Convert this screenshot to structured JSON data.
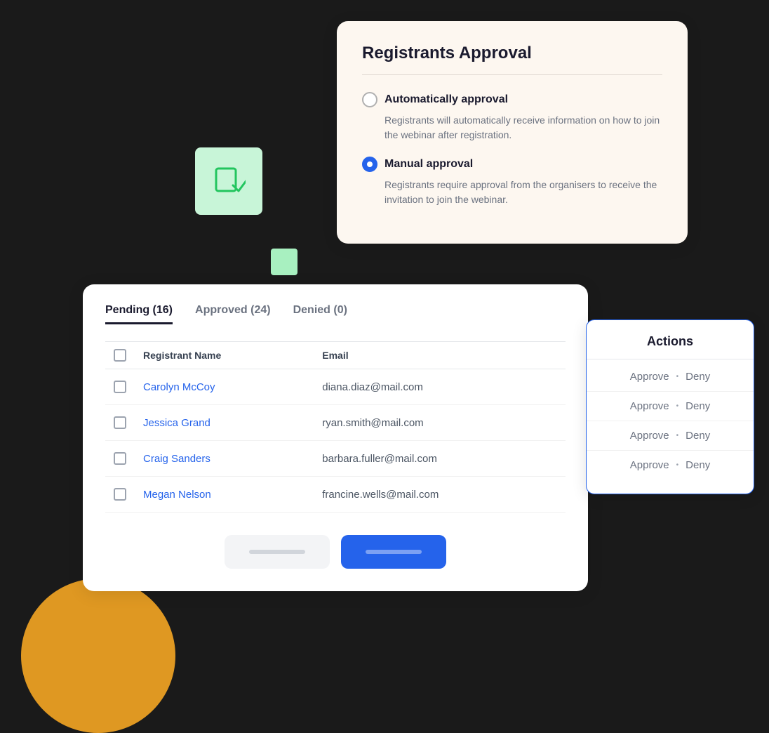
{
  "approval_card": {
    "title": "Registrants Approval",
    "options": [
      {
        "id": "auto",
        "label": "Automatically approval",
        "description": "Registrants will automatically receive information on how to join the webinar after registration.",
        "active": false
      },
      {
        "id": "manual",
        "label": "Manual approval",
        "description": "Registrants require approval from the organisers to receive the invitation to join the webinar.",
        "active": true
      }
    ]
  },
  "table": {
    "tabs": [
      {
        "label": "Pending (16)",
        "active": true
      },
      {
        "label": "Approved (24)",
        "active": false
      },
      {
        "label": "Denied (0)",
        "active": false
      }
    ],
    "columns": [
      "Registrant Name",
      "Email"
    ],
    "rows": [
      {
        "name": "Carolyn McCoy",
        "email": "diana.diaz@mail.com"
      },
      {
        "name": "Jessica Grand",
        "email": "ryan.smith@mail.com"
      },
      {
        "name": "Craig Sanders",
        "email": "barbara.fuller@mail.com"
      },
      {
        "name": "Megan Nelson",
        "email": "francine.wells@mail.com"
      }
    ]
  },
  "actions": {
    "title": "Actions",
    "rows": [
      {
        "approve": "Approve",
        "dot": "•",
        "deny": "Deny"
      },
      {
        "approve": "Approve",
        "dot": "•",
        "deny": "Deny"
      },
      {
        "approve": "Approve",
        "dot": "•",
        "deny": "Deny"
      },
      {
        "approve": "Approve",
        "dot": "•",
        "deny": "Deny"
      }
    ]
  },
  "buttons": {
    "secondary_label": "",
    "primary_label": ""
  }
}
